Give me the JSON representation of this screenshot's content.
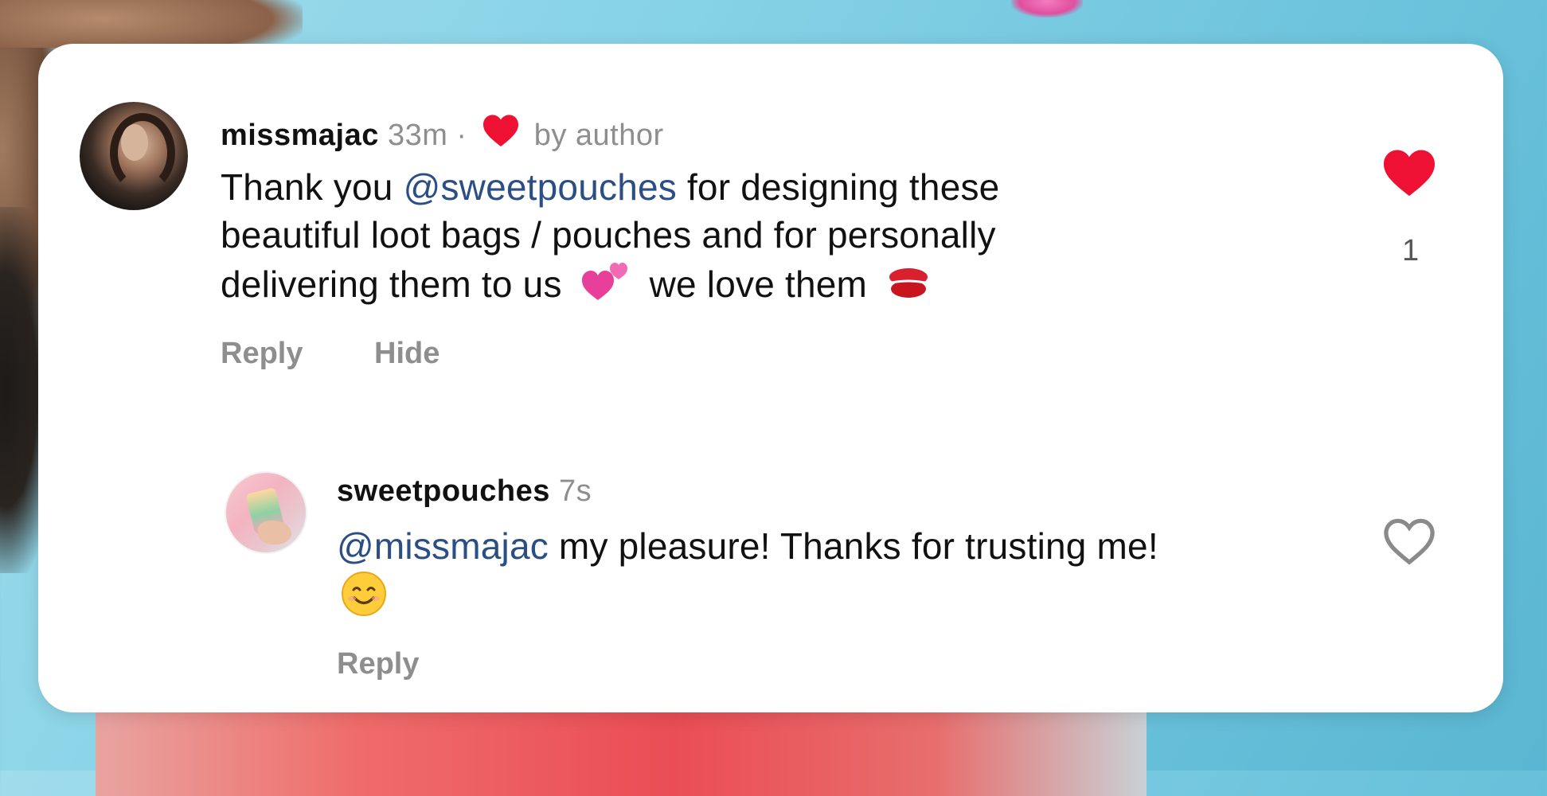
{
  "colors": {
    "like_red": "#ee1133",
    "mention_blue": "#2b4e84",
    "muted_text": "#8e8e8e"
  },
  "comment": {
    "username": "missmajac",
    "time": "33m",
    "separator": "·",
    "liked_by_author_label": "by author",
    "text_before_mention": "Thank you ",
    "mention": "@sweetpouches",
    "text_line1_rest": " for designing these",
    "text_line2": "beautiful loot bags / pouches and for personally",
    "text_line3_a": "delivering them to us",
    "text_line3_b": "we love them",
    "emoji_1": "two-hearts-icon",
    "emoji_2": "kiss-mark-icon",
    "like_count": "1",
    "reply_label": "Reply",
    "hide_label": "Hide"
  },
  "reply": {
    "username": "sweetpouches",
    "time": "7s",
    "mention": "@missmajac",
    "text": " my pleasure! Thanks for trusting me!",
    "emoji": "smiling-face-icon",
    "reply_label": "Reply"
  }
}
